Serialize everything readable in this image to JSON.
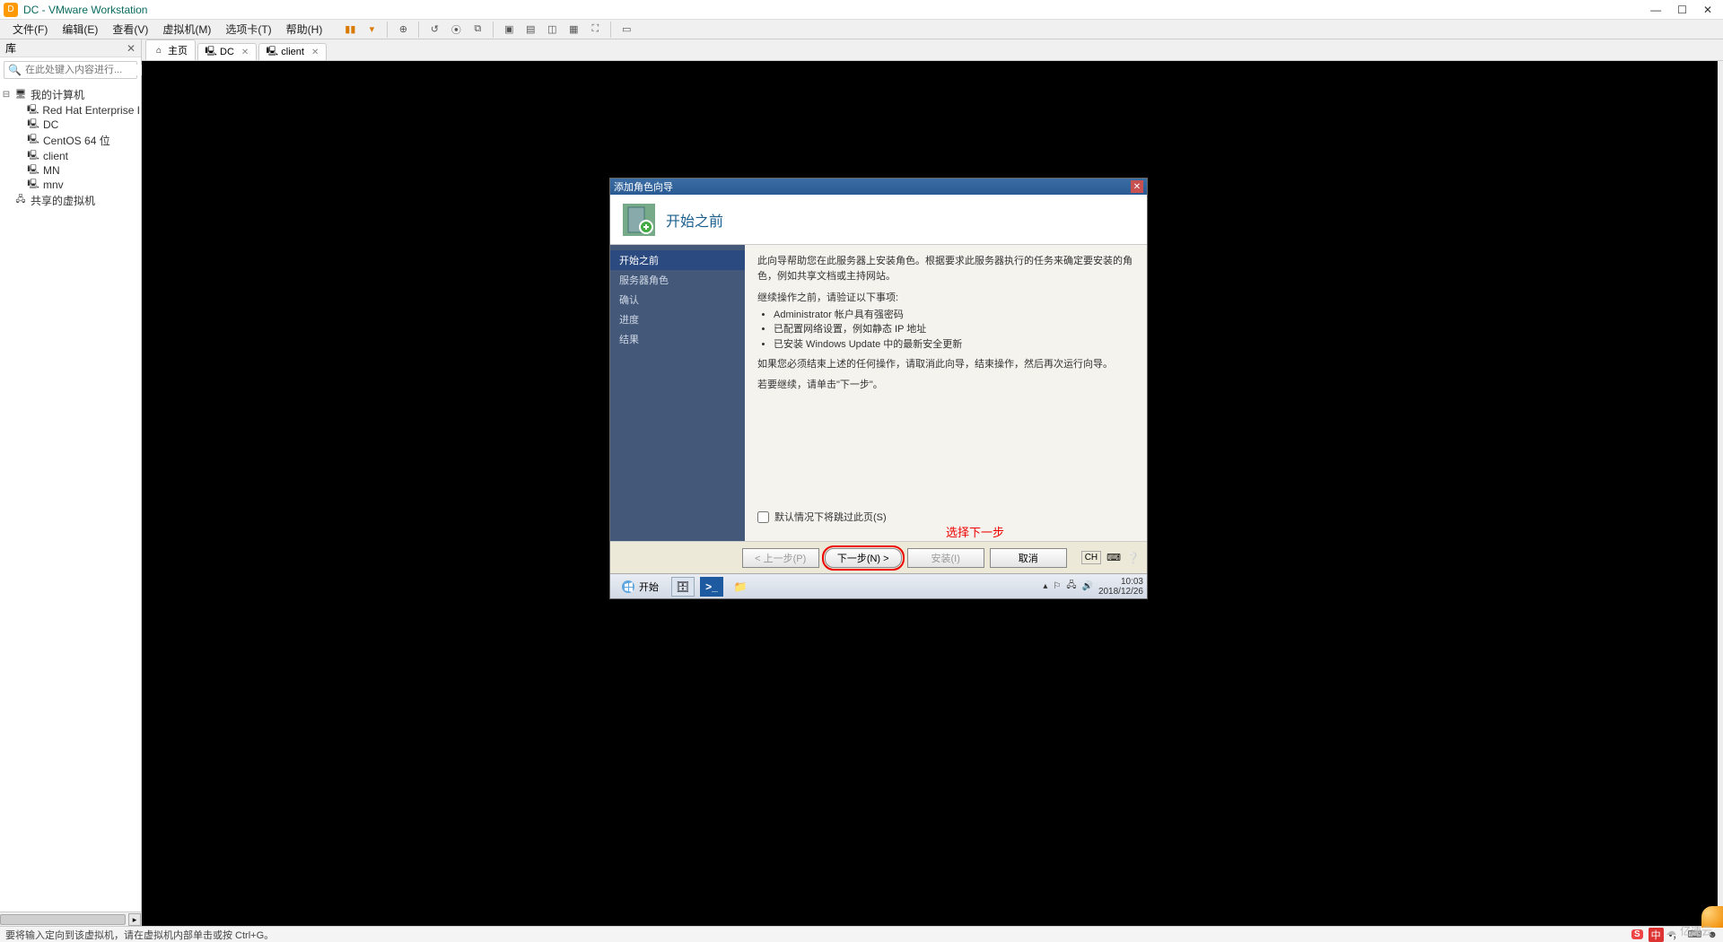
{
  "app": {
    "title": "DC - VMware Workstation"
  },
  "menus": [
    "文件(F)",
    "编辑(E)",
    "查看(V)",
    "虚拟机(M)",
    "选项卡(T)",
    "帮助(H)"
  ],
  "library": {
    "header": "库",
    "search_placeholder": "在此处键入内容进行...",
    "root": "我的计算机",
    "items": [
      "Red Hat Enterprise L",
      "DC",
      "CentOS 64 位",
      "client",
      "MN",
      "mnv"
    ],
    "shared": "共享的虚拟机"
  },
  "tabs": [
    {
      "label": "主页",
      "icon": "home",
      "closable": false
    },
    {
      "label": "DC",
      "icon": "vm",
      "closable": true,
      "active": true
    },
    {
      "label": "client",
      "icon": "vm",
      "closable": true
    }
  ],
  "dialog": {
    "title": "添加角色向导",
    "heading": "开始之前",
    "steps": [
      "开始之前",
      "服务器角色",
      "确认",
      "进度",
      "结果"
    ],
    "intro": "此向导帮助您在此服务器上安装角色。根据要求此服务器执行的任务来确定要安装的角色，例如共享文档或主持网站。",
    "verify_label": "继续操作之前，请验证以下事项:",
    "bullets": [
      "Administrator 帐户具有强密码",
      "已配置网络设置，例如静态 IP 地址",
      "已安装 Windows Update 中的最新安全更新"
    ],
    "cancel_hint": "如果您必须结束上述的任何操作，请取消此向导，结束操作，然后再次运行向导。",
    "continue_hint": "若要继续，请单击\"下一步\"。",
    "skip_checkbox": "默认情况下将跳过此页(S)",
    "annotation": "选择下一步",
    "buttons": {
      "prev": "< 上一步(P)",
      "next": "下一步(N) >",
      "install": "安装(I)",
      "cancel": "取消"
    },
    "lang_ind": "CH"
  },
  "guest_taskbar": {
    "start": "开始",
    "time": "10:03",
    "date": "2018/12/26"
  },
  "statusbar": {
    "text": "要将输入定向到该虚拟机，请在虚拟机内部单击或按 Ctrl+G。",
    "ime": "中"
  },
  "watermark": "亿速云"
}
